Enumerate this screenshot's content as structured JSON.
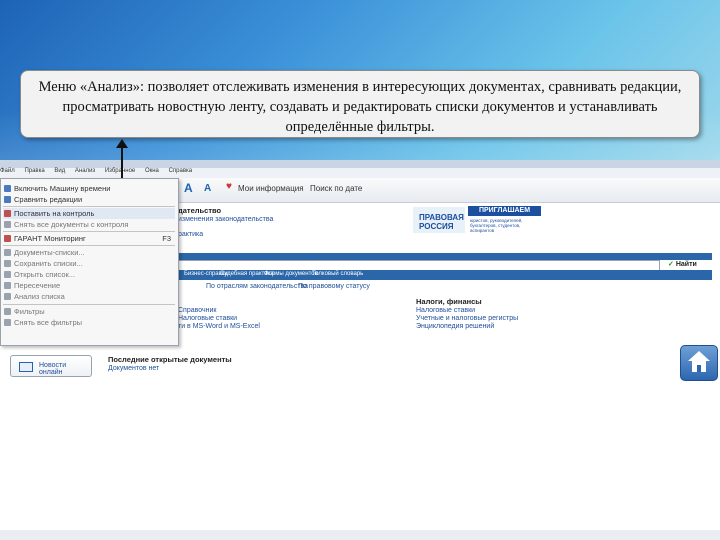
{
  "caption": {
    "text": "Меню «Анализ»: позволяет отслеживать изменения в интересующих документах, сравнивать редакции, просматривать новостную ленту, создавать и редактировать списки документов и устанавливать определённые фильтры."
  },
  "app": {
    "title": "Файл Правка Вид Анализ Избранное Окна Справка",
    "menu": [
      "Файл",
      "Правка",
      "Вид",
      "Анализ",
      "Избранное",
      "Окна",
      "Справка"
    ],
    "toolbar": {
      "font_big": "A",
      "font_small": "A",
      "my_info_label": "Мои информация",
      "news_label": "Поиск по дате"
    },
    "analysis_menu": [
      {
        "label": "Включить Машину времени",
        "dim": false,
        "icon_color": "#4a79c0"
      },
      {
        "label": "Сравнить редакции",
        "dim": false,
        "icon_color": "#4a79c0"
      },
      {
        "label": "Поставить на контроль",
        "dim": false,
        "icon_color": "#c0504d"
      },
      {
        "label": "Снять все документы с контроля",
        "dim": true,
        "icon_color": "#9aa3ad"
      },
      {
        "label": "ГАРАНТ Мониторинг",
        "dim": false,
        "icon_color": "#c0504d",
        "shortcut": "F3"
      },
      {
        "label": "Документы-списки...",
        "dim": true,
        "icon_color": "#9aa3ad"
      },
      {
        "label": "Сохранить списки...",
        "dim": true,
        "icon_color": "#9aa3ad"
      },
      {
        "label": "Открыть список...",
        "dim": true,
        "icon_color": "#9aa3ad"
      },
      {
        "label": "Пересечение",
        "dim": true,
        "icon_color": "#9aa3ad"
      },
      {
        "label": "Анализ списка",
        "dim": true,
        "icon_color": "#9aa3ad"
      },
      {
        "label": "Фильтры",
        "dim": true,
        "icon_color": "#9aa3ad"
      },
      {
        "label": "Снять все фильтры",
        "dim": true,
        "icon_color": "#9aa3ad"
      }
    ],
    "main": {
      "section_title": "дательство",
      "links_top": [
        "изменения законодательства",
        "рактика"
      ],
      "banner": {
        "line1": "ПРАВОВАЯ",
        "line2": "РОССИЯ",
        "invite": "ПРИГЛАШАЕМ",
        "small1": "юристов, руководителей,",
        "small2": "бухгалтеров, студентов,",
        "small3": "аспирантов"
      },
      "search_button": "Найти",
      "tabs": [
        "Бизнес-справки",
        "Судебная практика",
        "Формы документов",
        "Толковый словарь"
      ],
      "links_mid": [
        "По отраслям законодательства",
        "По правовому статусу"
      ],
      "taxes_title": "Налоги, финансы",
      "taxes_links": [
        "Налоговые ставки",
        "Учетные и налоговые регистры",
        "Энциклопедия решений"
      ],
      "left_links": [
        "Справочник",
        "Налоговые ставки",
        "ти в MS-Word и MS-Excel"
      ],
      "recent_title": "Последние открытые документы",
      "recent_link": "Документов нет"
    },
    "news_button": "Новости онлайн"
  }
}
